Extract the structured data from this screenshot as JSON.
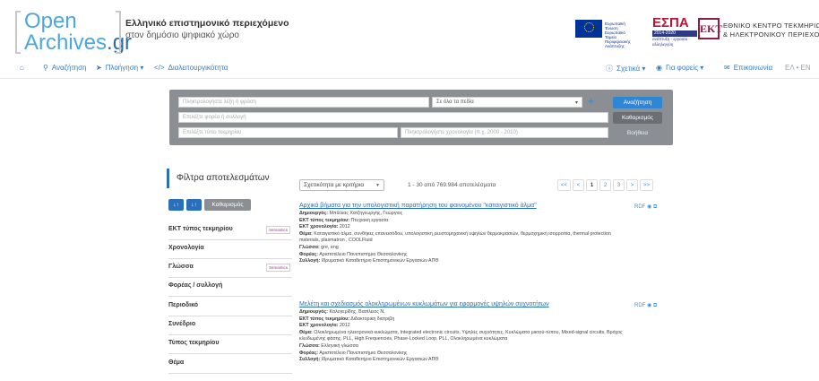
{
  "brand": {
    "line1": "Open",
    "line2_main": "Archives",
    "line2_suffix": ".gr",
    "tagline_1": "Ελληνικό επιστημονικό περιεχόμενο",
    "tagline_2": "στον δημόσιο ψηφιακό χώρο"
  },
  "sponsors": {
    "eu_text": "Ευρωπαϊκή Ένωση Ευρωπαϊκό Ταμείο Περιφερειακής Ανάπτυξης",
    "espa_title": "ΕΣΠΑ",
    "espa_years": "2014-2020",
    "espa_sub": "ανάπτυξη - εργασία - αλληλεγγύη",
    "ekt_mark": "ΕΚΤ",
    "ekt_line1": "ΕΘΝΙΚΟ ΚΕΝΤΡΟ ΤΕΚΜΗΡΙΩΣΗΣ",
    "ekt_line2": "& ΗΛΕΚΤΡΟΝΙΚΟΥ ΠΕΡΙΕΧΟΜΕΝ"
  },
  "nav": {
    "search": "Αναζήτηση",
    "browse": "Πλοήγηση ▾",
    "interop": "Διαλειτουργικότητα",
    "about": "Σχετικά ▾",
    "providers": "Για φορείς ▾",
    "contact": "Επικοινωνία",
    "lang": "ΕΛ • EN"
  },
  "search": {
    "query_placeholder": "Πληκτρολογήστε λέξη ή φράση",
    "field_select": "Σε όλα τα πεδία",
    "provider_placeholder": "Επιλέξτε φορέα ή συλλογή",
    "type_placeholder": "Επιλέξτε τύπο τεκμηρίου",
    "date_placeholder": "Πληκτρολογήστε χρονολογία (π.χ. 2000 - 2010)",
    "search_btn": "Αναζήτηση",
    "clear_btn": "Καθαρισμός",
    "help_btn": "Βοήθεια"
  },
  "filters": {
    "title": "Φίλτρα αποτελεσμάτων",
    "sort_az": "↓↑",
    "sort_za": "↓↑",
    "clear": "Καθαρισμός",
    "semantics_label": "Semantics",
    "items": [
      "ΕΚΤ τύπος τεκμηρίου",
      "Χρονολογία",
      "Γλώσσα",
      "Φορέας / συλλογή",
      "Περιοδικό",
      "Συνέδριο",
      "Τύπος τεκμηρίου",
      "Θέμα"
    ]
  },
  "results": {
    "sort_label": "Σχετικότητα με κριτήρια",
    "count_text": "1 - 30  από  769.984  αποτελέσματα",
    "pager": [
      "<<",
      "<",
      "1",
      "2",
      "3",
      ">",
      ">>"
    ],
    "rdf_label": "RDF",
    "records": [
      {
        "title": "Αρχικά βήματα για την υπολογιστική παρατήρηση του φαινομένου \"καταιγιστικό άλμα\"",
        "creator_label": "Δημιουργός:",
        "creator": "Μπίλλιας Χατζηγεωργής, Γεώργιος",
        "type_label": "ΕΚΤ τύπος τεκμηρίου:",
        "type": "Πτυχιακή εργασία",
        "date_label": "ΕΚΤ χρονολογία:",
        "date": "2012",
        "subject_label": "Θέμα:",
        "subject": "Καταιγιστικό άλμα, συνθήκες επανεισόδου, υπολογιστική ρευστομηχανική υψηλών θερμοκρασιών, θερμοχημική ισορροπία, thermal protection materials, plasmatron , COOLFluid",
        "lang_label": "Γλώσσα:",
        "lang": "gre, eng",
        "provider_label": "Φορέας:",
        "provider": "Αριστοτέλειο Πανεπιστήμιο Θεσσαλονίκης",
        "collection_label": "Συλλογή:",
        "collection": "Ιδρυματικό Καταθετήριο Επιστημονικών Εργασιών ΑΠΘ"
      },
      {
        "title": "Μελέτη και σχεδιασμός ολοκληρωμένων κυκλωμάτων για εφαρμογές υψηλών συχνοτήτων",
        "creator_label": "Δημιουργός:",
        "creator": "Καλογερίδης, Βασίλειος Ν.",
        "type_label": "ΕΚΤ τύπος τεκμηρίου:",
        "type": "Διδακτορική διατριβή",
        "date_label": "ΕΚΤ χρονολογία:",
        "date": "2012",
        "subject_label": "Θέμα:",
        "subject": "Ολοκληρωμένα ηλεκτρονικά κυκλώματα, Integrated electronic circuits, Υψηλές συχνότητες, Κυκλώματα μικτού-τύπου, Mixed-signal circuits, Βρόχος κλειδωμένης φάσης, PLL, High Frequencies, Phase-Locked Loop, PLL, Ολοκληρωμένα κυκλώματα",
        "lang_label": "Γλώσσα:",
        "lang": "Ελληνική γλώσσα",
        "provider_label": "Φορέας:",
        "provider": "Αριστοτέλειο Πανεπιστήμιο Θεσσαλονίκης",
        "collection_label": "Συλλογή:",
        "collection": "Ιδρυματικό Καταθετήριο Επιστημονικών Εργασιών ΑΠΘ"
      }
    ]
  },
  "colors": {
    "brand_blue": "#4da6de",
    "link_blue": "#2a6fba",
    "primary_button": "#2f86d6",
    "panel_gray": "#8b8e93"
  }
}
